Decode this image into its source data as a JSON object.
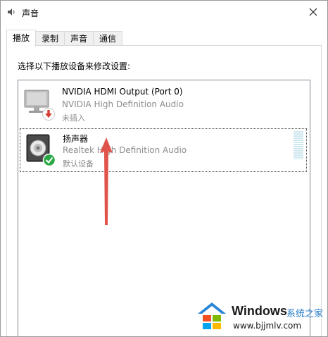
{
  "window": {
    "title": "声音"
  },
  "tabs": [
    {
      "label": "播放",
      "active": true
    },
    {
      "label": "录制",
      "active": false
    },
    {
      "label": "声音",
      "active": false
    },
    {
      "label": "通信",
      "active": false
    }
  ],
  "panel": {
    "instructions": "选择以下播放设备来修改设置:"
  },
  "devices": [
    {
      "name": "NVIDIA HDMI Output (Port 0)",
      "driver": "NVIDIA High Definition Audio",
      "status": "未插入",
      "icon": "monitor-icon",
      "badge": "unplugged-badge-icon",
      "selected": false
    },
    {
      "name": "扬声器",
      "driver": "Realtek High Definition Audio",
      "status": "默认设备",
      "icon": "speaker-icon",
      "badge": "default-check-badge-icon",
      "selected": true
    }
  ],
  "annotation": {
    "arrow_color": "#e0534a"
  },
  "watermark": {
    "brand": "Windows",
    "brand_cn": "系统之家",
    "url": "www.bjjmlv.com"
  },
  "colors": {
    "disabled_text": "#8c8c8c",
    "check_green": "#2aa846",
    "unplugged_red": "#d63b2f",
    "meter": "#cfe7ef"
  }
}
